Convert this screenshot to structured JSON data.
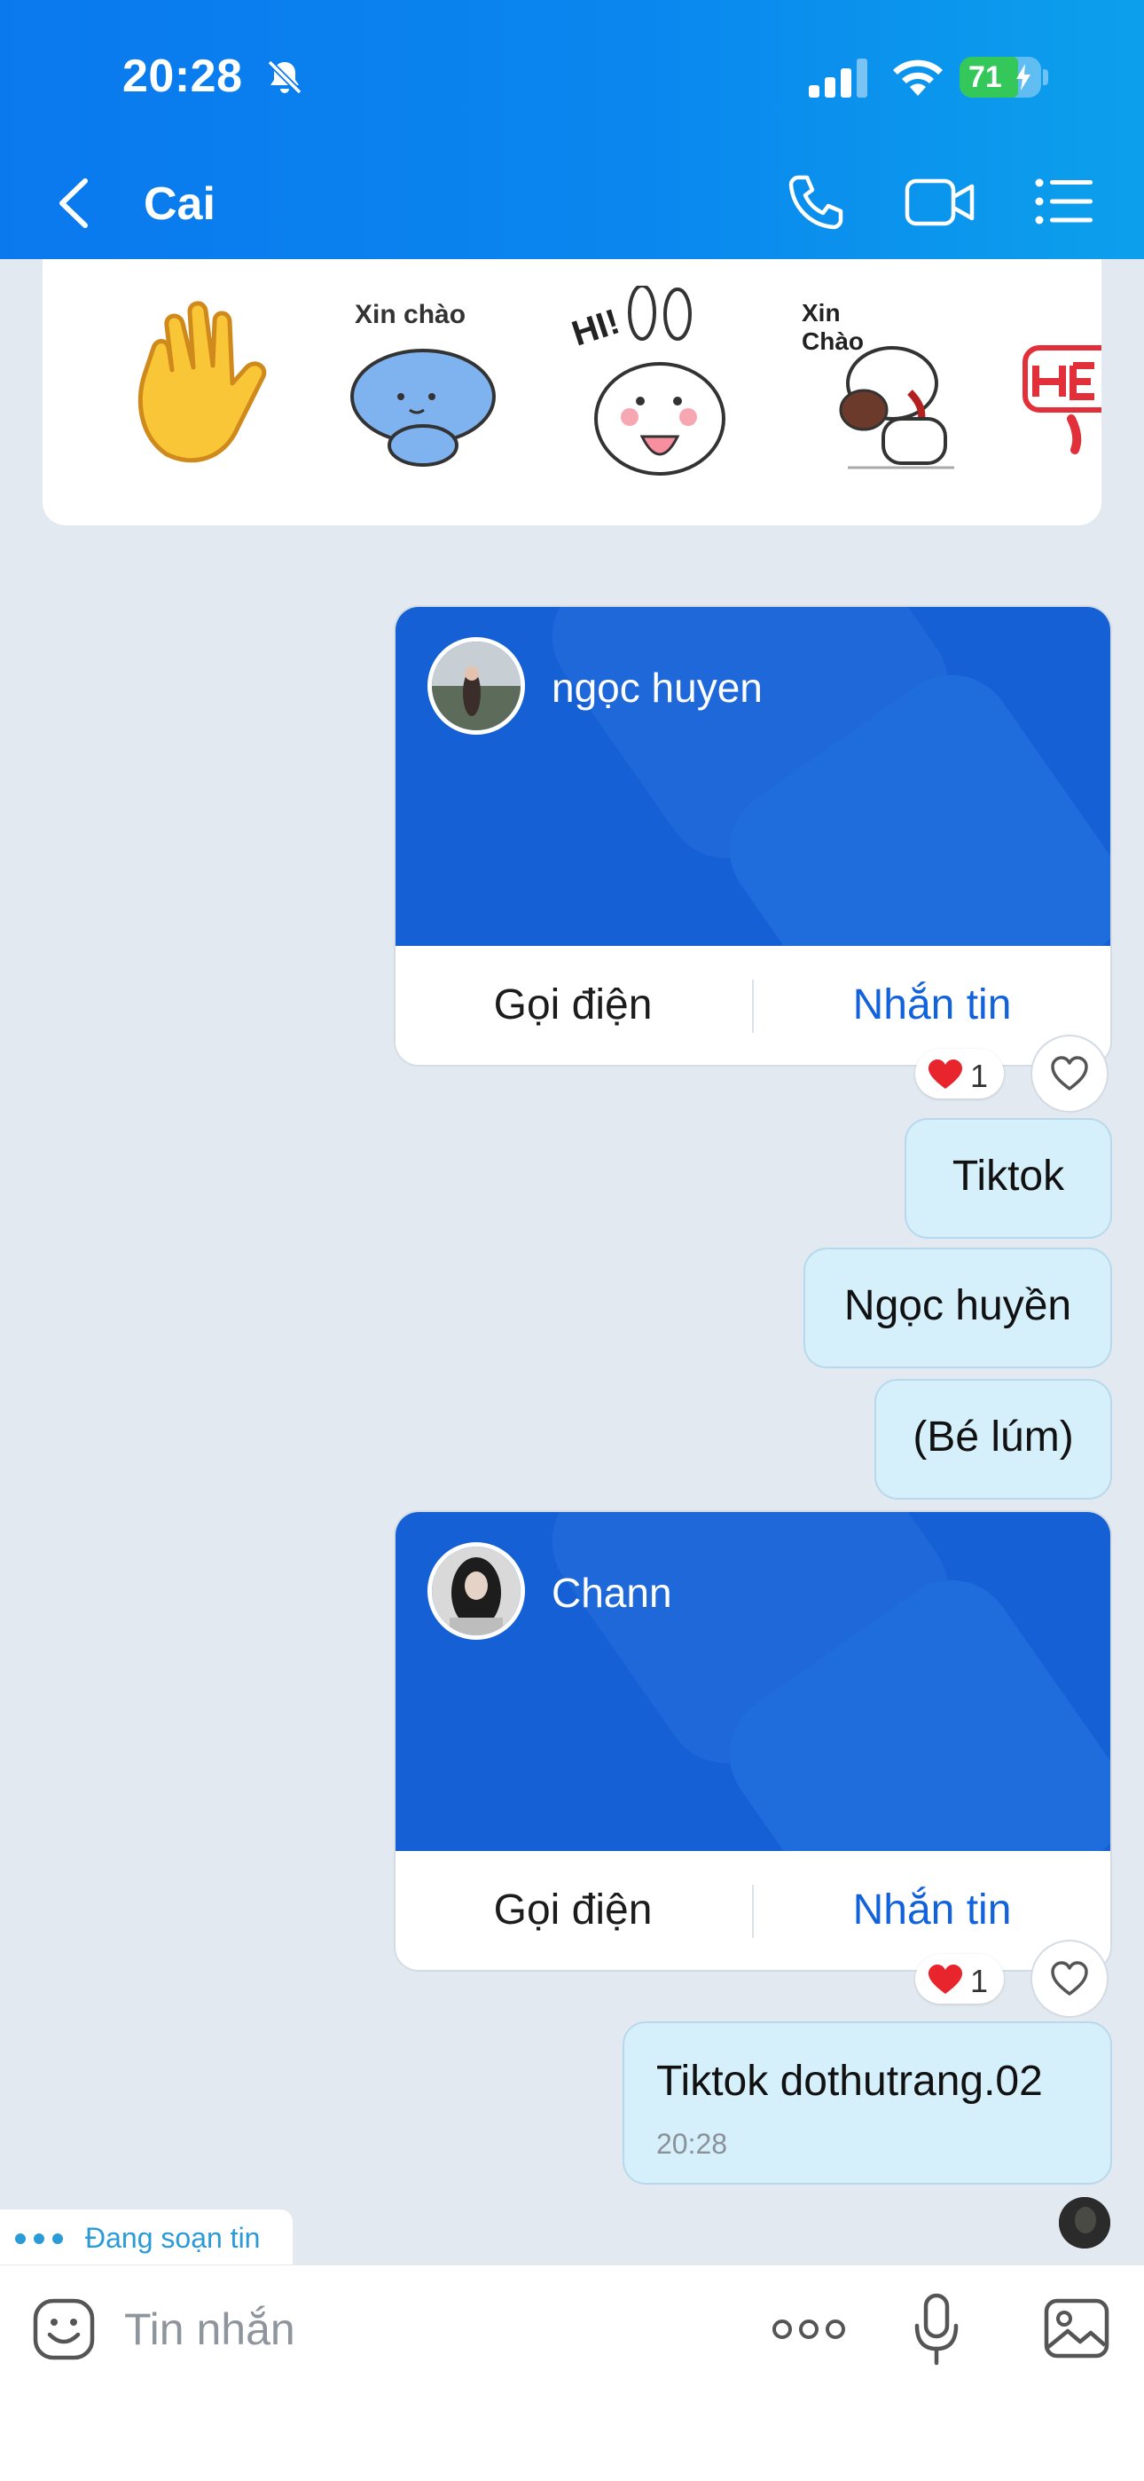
{
  "status_bar": {
    "time": "20:28",
    "battery": "71"
  },
  "header": {
    "title": "Cai"
  },
  "stickers": [
    "waving-hand",
    "xin-chao-cat",
    "hi-bunny",
    "xin-chao-dog",
    "hello-partial"
  ],
  "sticker_texts": {
    "cat": "Xin chào",
    "bunny": "HI!",
    "dog_line1": "Xin",
    "dog_line2": "Chào"
  },
  "cards": [
    {
      "name": "ngọc huyen",
      "call_label": "Gọi điện",
      "message_label": "Nhắn tin",
      "reaction_count": "1"
    },
    {
      "name": "Chann",
      "call_label": "Gọi điện",
      "message_label": "Nhắn tin",
      "reaction_count": "1"
    }
  ],
  "messages": [
    {
      "text": "Tiktok"
    },
    {
      "text": "Ngọc huyền"
    },
    {
      "text": "(Bé lúm)"
    },
    {
      "text": "Tiktok dothutrang.02",
      "time": "20:28"
    }
  ],
  "typing_indicator": "Đang soạn tin",
  "input": {
    "placeholder": "Tin nhắn"
  },
  "colors": {
    "header": "#0a86ee",
    "card": "#1660d6",
    "bubble": "#d5effb",
    "accent_link": "#1262dc"
  }
}
